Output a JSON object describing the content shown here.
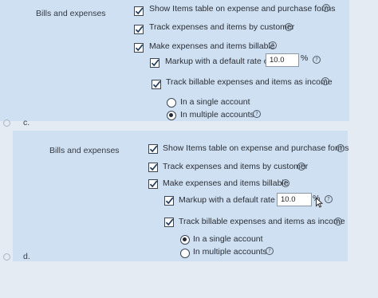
{
  "choices": [
    {
      "letter": "c.",
      "section_label": "Bills and expenses",
      "options": {
        "show_items_table": {
          "label": "Show Items table on expense and purchase forms",
          "checked": true
        },
        "track_expenses": {
          "label": "Track expenses and items by customer",
          "checked": true
        },
        "make_billable": {
          "label": "Make expenses and items billable",
          "checked": true
        },
        "markup": {
          "label": "Markup with a default rate of",
          "checked": true,
          "value": "10.0",
          "unit": "%"
        },
        "track_billable": {
          "label": "Track billable expenses and items as income",
          "checked": true
        },
        "single_account": {
          "label": "In a single account",
          "selected": false
        },
        "multiple_accounts": {
          "label": "In multiple accounts",
          "selected": true
        }
      }
    },
    {
      "letter": "d.",
      "section_label": "Bills and expenses",
      "options": {
        "show_items_table": {
          "label": "Show Items table on expense and purchase forms",
          "checked": true
        },
        "track_expenses": {
          "label": "Track expenses and items by customer",
          "checked": true
        },
        "make_billable": {
          "label": "Make expenses and items billable",
          "checked": true
        },
        "markup": {
          "label": "Markup with a default rate of",
          "checked": true,
          "value": "10.0",
          "unit": "%"
        },
        "track_billable": {
          "label": "Track billable expenses and items as income",
          "checked": true
        },
        "single_account": {
          "label": "In a single account",
          "selected": true
        },
        "multiple_accounts": {
          "label": "In multiple accounts",
          "selected": false
        }
      }
    }
  ],
  "icons": {
    "info": "info-circle-icon",
    "check": "checkmark-icon",
    "cursor": "mouse-pointer-icon"
  },
  "colors": {
    "panel": "#cfe0f2",
    "background": "#e4ebf2"
  }
}
